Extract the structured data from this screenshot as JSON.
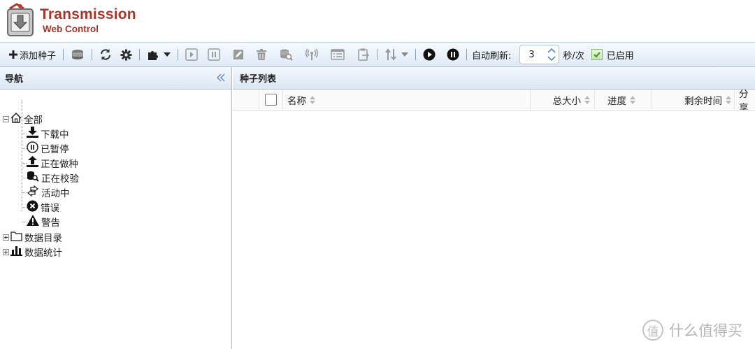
{
  "app": {
    "logo_title": "Transmission",
    "logo_subtitle": "Web Control",
    "brand_color": "#a8352a"
  },
  "toolbar": {
    "add_torrent_label": "添加种子",
    "auto_refresh_label": "自动刷新:",
    "refresh_interval_value": "3",
    "interval_unit": "秒/次",
    "enabled_label": "已启用",
    "enabled": true,
    "icons": [
      "plus-icon",
      "remove-icon",
      "refresh-icon",
      "settings-icon",
      "plugin-icon",
      "start-icon",
      "pause-icon",
      "rename-icon",
      "delete-icon",
      "verify-icon",
      "reannounce-icon",
      "properties-icon",
      "copy-path-icon",
      "speed-limit-icon",
      "start-all-icon",
      "pause-all-icon"
    ]
  },
  "nav": {
    "title": "导航",
    "root_label": "全部",
    "items": [
      {
        "label": "下载中",
        "icon": "download-icon"
      },
      {
        "label": "已暂停",
        "icon": "paused-icon"
      },
      {
        "label": "正在做种",
        "icon": "upload-icon"
      },
      {
        "label": "正在校验",
        "icon": "verify-icon"
      },
      {
        "label": "活动中",
        "icon": "active-icon"
      },
      {
        "label": "错误",
        "icon": "error-icon"
      },
      {
        "label": "警告",
        "icon": "warning-icon"
      }
    ],
    "folders_label": "数据目录",
    "stats_label": "数据统计"
  },
  "main": {
    "title": "种子列表",
    "columns": [
      "名称",
      "总大小",
      "进度",
      "剩余时间",
      "分享"
    ]
  },
  "watermark": {
    "text": "什么值得买",
    "glyph": "值"
  }
}
